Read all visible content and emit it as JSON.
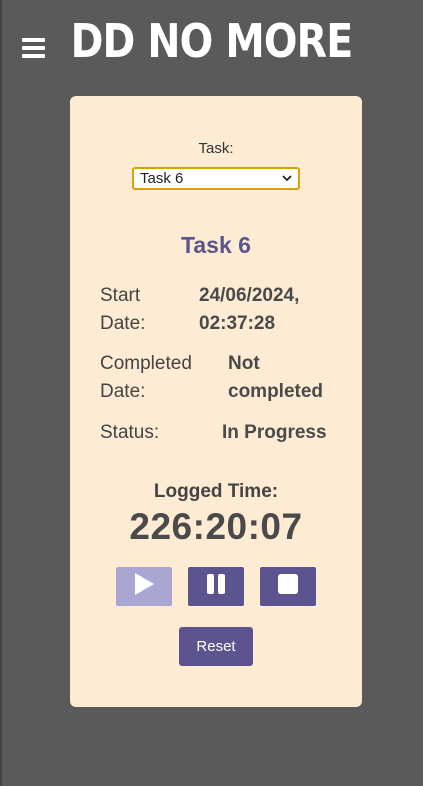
{
  "header": {
    "title": "DD NO MORE"
  },
  "task": {
    "label": "Task:",
    "selected": "Task 6",
    "heading": "Task 6"
  },
  "details": {
    "start_label_1": "Start",
    "start_label_2": "Date:",
    "start_value_1": "24/06/2024,",
    "start_value_2": "02:37:28",
    "completed_label_1": "Completed",
    "completed_label_2": "Date:",
    "completed_value_1": "Not",
    "completed_value_2": "completed",
    "status_label": "Status:",
    "status_value": "In Progress"
  },
  "timer": {
    "label": "Logged Time:",
    "value": "226:20:07"
  },
  "controls": {
    "play_icon": "play-icon",
    "pause_icon": "pause-icon",
    "stop_icon": "stop-icon",
    "reset_label": "Reset"
  },
  "colors": {
    "background": "#5a5a5a",
    "card": "#fdebd3",
    "accent": "#5b548f",
    "accent_disabled": "#a9a6d1",
    "select_border": "#d9a300"
  }
}
